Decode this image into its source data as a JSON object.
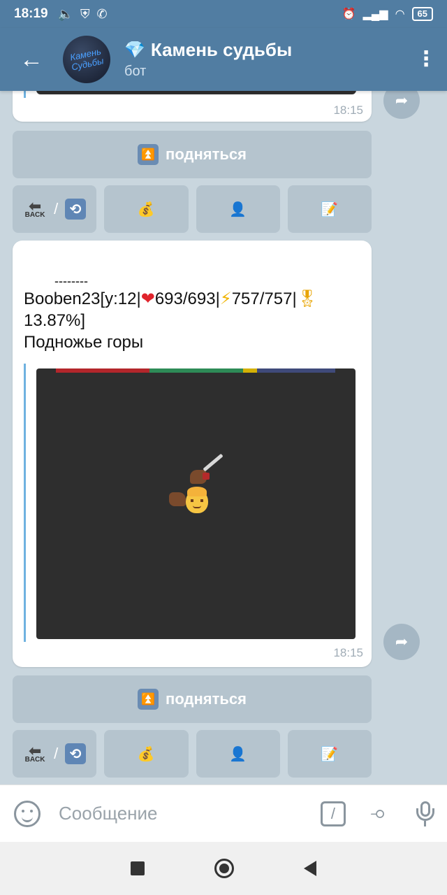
{
  "status_bar": {
    "time": "18:19",
    "battery": "65"
  },
  "header": {
    "title": "Камень судьбы",
    "subtitle": "бот",
    "avatar_text": "Камень Судьбы"
  },
  "messages": [
    {
      "time": "18:15"
    },
    {
      "dashes": "--------",
      "player": "Booben23",
      "level": "[у:12|",
      "hp": "693/693",
      "sep1": "|",
      "energy": "757/757",
      "sep2": "|",
      "xp": "13.87%]",
      "location": "Подножье горы",
      "time": "18:15"
    }
  ],
  "keyboard": {
    "up_label": "подняться",
    "back_label": "BACK",
    "slash": "/"
  },
  "input": {
    "placeholder": "Сообщение"
  },
  "colors": {
    "header": "#517da2",
    "hp_bar": "#b3262b",
    "energy_bar": "#2e8b57",
    "xp_bar": "#d4b106",
    "mana_bar": "#3f4a7a"
  }
}
